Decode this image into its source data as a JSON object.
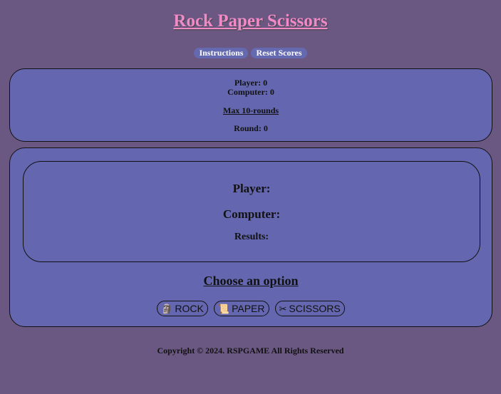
{
  "header": {
    "title": "Rock Paper Scissors",
    "instructions_label": "Instructions",
    "reset_label": "Reset Scores"
  },
  "score": {
    "player_label": "Player: 0",
    "computer_label": "Computer: 0",
    "max_rounds_label": "Max 10-rounds",
    "round_label": "Round: 0"
  },
  "game": {
    "player_label": "Player:",
    "computer_label": "Computer:",
    "results_label": "Results:",
    "choose_label": "Choose an option",
    "choices": [
      {
        "label": "ROCK",
        "icon": "rock-icon",
        "glyph": "🗿"
      },
      {
        "label": "PAPER",
        "icon": "scroll-icon",
        "glyph": "📜"
      },
      {
        "label": "SCISSORS",
        "icon": "scissors-icon",
        "glyph": "✂"
      }
    ]
  },
  "footer": {
    "copyright": "Copyright © 2024. RSPGAME All Rights Reserved"
  },
  "colors": {
    "background": "#6a5882",
    "panel": "#6467b0",
    "title": "#f08ac8"
  }
}
